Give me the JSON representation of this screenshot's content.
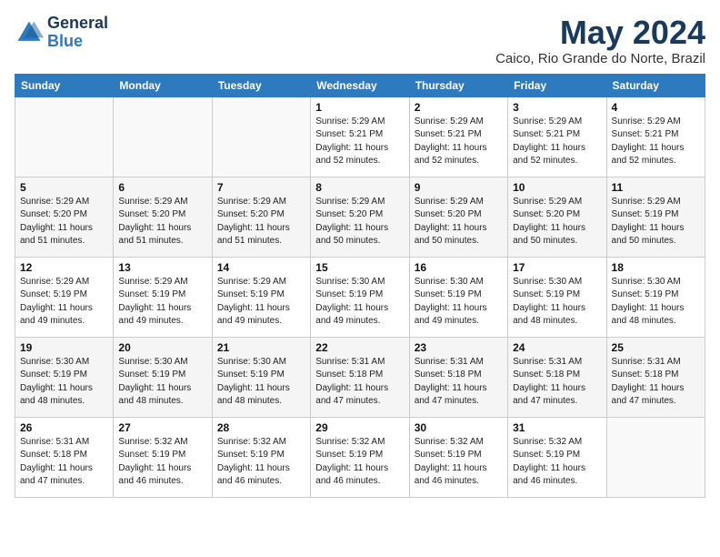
{
  "header": {
    "logo_general": "General",
    "logo_blue": "Blue",
    "month_year": "May 2024",
    "location": "Caico, Rio Grande do Norte, Brazil"
  },
  "weekdays": [
    "Sunday",
    "Monday",
    "Tuesday",
    "Wednesday",
    "Thursday",
    "Friday",
    "Saturday"
  ],
  "weeks": [
    [
      {
        "day": "",
        "info": ""
      },
      {
        "day": "",
        "info": ""
      },
      {
        "day": "",
        "info": ""
      },
      {
        "day": "1",
        "info": "Sunrise: 5:29 AM\nSunset: 5:21 PM\nDaylight: 11 hours and 52 minutes."
      },
      {
        "day": "2",
        "info": "Sunrise: 5:29 AM\nSunset: 5:21 PM\nDaylight: 11 hours and 52 minutes."
      },
      {
        "day": "3",
        "info": "Sunrise: 5:29 AM\nSunset: 5:21 PM\nDaylight: 11 hours and 52 minutes."
      },
      {
        "day": "4",
        "info": "Sunrise: 5:29 AM\nSunset: 5:21 PM\nDaylight: 11 hours and 52 minutes."
      }
    ],
    [
      {
        "day": "5",
        "info": "Sunrise: 5:29 AM\nSunset: 5:20 PM\nDaylight: 11 hours and 51 minutes."
      },
      {
        "day": "6",
        "info": "Sunrise: 5:29 AM\nSunset: 5:20 PM\nDaylight: 11 hours and 51 minutes."
      },
      {
        "day": "7",
        "info": "Sunrise: 5:29 AM\nSunset: 5:20 PM\nDaylight: 11 hours and 51 minutes."
      },
      {
        "day": "8",
        "info": "Sunrise: 5:29 AM\nSunset: 5:20 PM\nDaylight: 11 hours and 50 minutes."
      },
      {
        "day": "9",
        "info": "Sunrise: 5:29 AM\nSunset: 5:20 PM\nDaylight: 11 hours and 50 minutes."
      },
      {
        "day": "10",
        "info": "Sunrise: 5:29 AM\nSunset: 5:20 PM\nDaylight: 11 hours and 50 minutes."
      },
      {
        "day": "11",
        "info": "Sunrise: 5:29 AM\nSunset: 5:19 PM\nDaylight: 11 hours and 50 minutes."
      }
    ],
    [
      {
        "day": "12",
        "info": "Sunrise: 5:29 AM\nSunset: 5:19 PM\nDaylight: 11 hours and 49 minutes."
      },
      {
        "day": "13",
        "info": "Sunrise: 5:29 AM\nSunset: 5:19 PM\nDaylight: 11 hours and 49 minutes."
      },
      {
        "day": "14",
        "info": "Sunrise: 5:29 AM\nSunset: 5:19 PM\nDaylight: 11 hours and 49 minutes."
      },
      {
        "day": "15",
        "info": "Sunrise: 5:30 AM\nSunset: 5:19 PM\nDaylight: 11 hours and 49 minutes."
      },
      {
        "day": "16",
        "info": "Sunrise: 5:30 AM\nSunset: 5:19 PM\nDaylight: 11 hours and 49 minutes."
      },
      {
        "day": "17",
        "info": "Sunrise: 5:30 AM\nSunset: 5:19 PM\nDaylight: 11 hours and 48 minutes."
      },
      {
        "day": "18",
        "info": "Sunrise: 5:30 AM\nSunset: 5:19 PM\nDaylight: 11 hours and 48 minutes."
      }
    ],
    [
      {
        "day": "19",
        "info": "Sunrise: 5:30 AM\nSunset: 5:19 PM\nDaylight: 11 hours and 48 minutes."
      },
      {
        "day": "20",
        "info": "Sunrise: 5:30 AM\nSunset: 5:19 PM\nDaylight: 11 hours and 48 minutes."
      },
      {
        "day": "21",
        "info": "Sunrise: 5:30 AM\nSunset: 5:19 PM\nDaylight: 11 hours and 48 minutes."
      },
      {
        "day": "22",
        "info": "Sunrise: 5:31 AM\nSunset: 5:18 PM\nDaylight: 11 hours and 47 minutes."
      },
      {
        "day": "23",
        "info": "Sunrise: 5:31 AM\nSunset: 5:18 PM\nDaylight: 11 hours and 47 minutes."
      },
      {
        "day": "24",
        "info": "Sunrise: 5:31 AM\nSunset: 5:18 PM\nDaylight: 11 hours and 47 minutes."
      },
      {
        "day": "25",
        "info": "Sunrise: 5:31 AM\nSunset: 5:18 PM\nDaylight: 11 hours and 47 minutes."
      }
    ],
    [
      {
        "day": "26",
        "info": "Sunrise: 5:31 AM\nSunset: 5:18 PM\nDaylight: 11 hours and 47 minutes."
      },
      {
        "day": "27",
        "info": "Sunrise: 5:32 AM\nSunset: 5:19 PM\nDaylight: 11 hours and 46 minutes."
      },
      {
        "day": "28",
        "info": "Sunrise: 5:32 AM\nSunset: 5:19 PM\nDaylight: 11 hours and 46 minutes."
      },
      {
        "day": "29",
        "info": "Sunrise: 5:32 AM\nSunset: 5:19 PM\nDaylight: 11 hours and 46 minutes."
      },
      {
        "day": "30",
        "info": "Sunrise: 5:32 AM\nSunset: 5:19 PM\nDaylight: 11 hours and 46 minutes."
      },
      {
        "day": "31",
        "info": "Sunrise: 5:32 AM\nSunset: 5:19 PM\nDaylight: 11 hours and 46 minutes."
      },
      {
        "day": "",
        "info": ""
      }
    ]
  ]
}
